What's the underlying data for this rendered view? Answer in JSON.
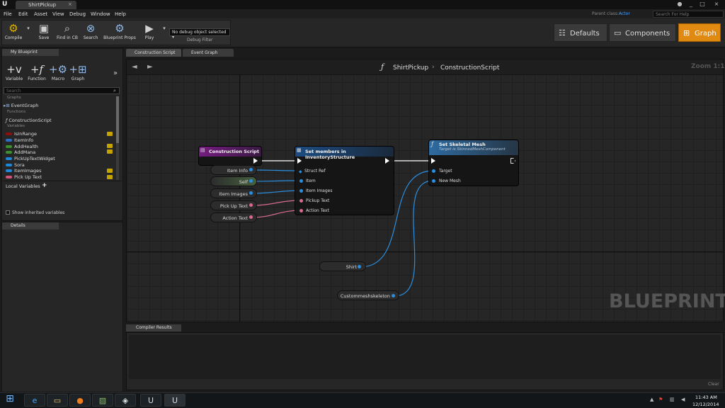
{
  "window": {
    "tab_title": "ShirtPickup",
    "parent_class_label": "Parent class:",
    "parent_class_value": "Actor",
    "help_placeholder": "Search For Help"
  },
  "menu": [
    "File",
    "Edit",
    "Asset",
    "View",
    "Debug",
    "Window",
    "Help"
  ],
  "toolbar": {
    "compile": "Compile",
    "save": "Save",
    "find_in_cb": "Find in CB",
    "search": "Search",
    "blueprint_props": "Blueprint Props",
    "play": "Play",
    "debug_object": "No debug object selected",
    "debug_filter": "Debug Filter"
  },
  "modes": {
    "defaults": "Defaults",
    "components": "Components",
    "graph": "Graph"
  },
  "my_blueprint": {
    "tab": "My Blueprint",
    "add_buttons": [
      "Variable",
      "Function",
      "Macro",
      "Graph"
    ],
    "search_placeholder": "Search",
    "sections": {
      "graphs": "Graphs",
      "functions": "Functions",
      "variables": "Variables"
    },
    "graphs": [
      "EventGraph"
    ],
    "functions": [
      "ConstructionScript"
    ],
    "variables": [
      {
        "name": "IsInRange",
        "color": "#8a1010"
      },
      {
        "name": "ItemInfo",
        "color": "#2d6fc4"
      },
      {
        "name": "AddHealth",
        "color": "#3c8f2e"
      },
      {
        "name": "AddMana",
        "color": "#3c8f2e"
      },
      {
        "name": "PickUpTextWidget",
        "color": "#1d87d8"
      },
      {
        "name": "Sora",
        "color": "#1d87d8"
      },
      {
        "name": "ItemImages",
        "color": "#1d87d8"
      },
      {
        "name": "Pick Up Text",
        "color": "#d1557a"
      }
    ],
    "local_variables": "Local Variables",
    "show_inherited": "Show inherited variables"
  },
  "details": {
    "tab": "Details"
  },
  "graph_tabs": [
    "Construction Script",
    "Event Graph"
  ],
  "graph": {
    "breadcrumb": [
      "ShirtPickup",
      "ConstructionScript"
    ],
    "zoom": "Zoom 1:1",
    "watermark": "BLUEPRINT",
    "nodes": {
      "construction_script": {
        "title": "Construction Script"
      },
      "set_members": {
        "title": "Set members in InventoryStructure",
        "pins": [
          "Struct Ref",
          "Item",
          "Item Images",
          "Pickup Text",
          "Action Text"
        ]
      },
      "set_skeletal_mesh": {
        "title": "Set Skeletal Mesh",
        "subtitle": "Target is SkinnedMeshComponent",
        "pins": [
          "Target",
          "New Mesh"
        ]
      }
    },
    "variable_nodes": [
      "Item Info",
      "Self",
      "Item Images",
      "Pick Up Text",
      "Action Text",
      "Shirt",
      "Custommeshskeleton"
    ]
  },
  "compiler": {
    "tab": "Compiler Results",
    "clear": "Clear"
  },
  "taskbar": {
    "time": "11:43 AM",
    "date": "12/12/2014"
  }
}
